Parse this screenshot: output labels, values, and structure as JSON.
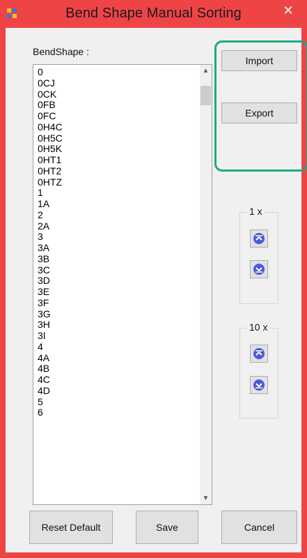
{
  "window": {
    "title": "Bend Shape Manual Sorting",
    "close_glyph": "✕"
  },
  "list": {
    "label": "BendShape :",
    "items": [
      "0",
      "0CJ",
      "0CK",
      "0FB",
      "0FC",
      "0H4C",
      "0H5C",
      "0H5K",
      "0HT1",
      "0HT2",
      "0HTZ",
      "1",
      "1A",
      "2",
      "2A",
      "3",
      "3A",
      "3B",
      "3C",
      "3D",
      "3E",
      "3F",
      "3G",
      "3H",
      "3I",
      "4",
      "4A",
      "4B",
      "4C",
      "4D",
      "5",
      "6"
    ]
  },
  "actions": {
    "import_label": "Import",
    "export_label": "Export"
  },
  "step_1x": {
    "label": "1 x",
    "up_icon": "move-up-icon",
    "down_icon": "move-down-icon"
  },
  "step_10x": {
    "label": "10 x",
    "up_icon": "move-up-icon",
    "down_icon": "move-down-icon"
  },
  "footer": {
    "reset_label": "Reset Default",
    "save_label": "Save",
    "cancel_label": "Cancel"
  },
  "colors": {
    "window_frame": "#ef4446",
    "highlight": "#1ea888",
    "client_bg": "#f0f0f0",
    "icon_blue": "#4a5ad8"
  }
}
